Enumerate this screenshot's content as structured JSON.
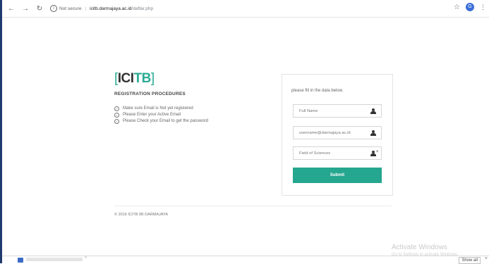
{
  "browser": {
    "security_label": "Not secure",
    "domain": "icitb.darmajaya.ac.id",
    "path": "/daftar.php",
    "profile_initial": "G"
  },
  "logo": {
    "ici": "ICI",
    "tb": "TB",
    "open_bracket": "[",
    "close_bracket": "]"
  },
  "procedures": {
    "title": "REGISTRATION PROCEDURES",
    "steps": [
      "Make sure Email is Not yet registered",
      "Please Enter your Active Email",
      "Please Check your Email to get the password"
    ]
  },
  "form": {
    "intro": "please fill in the data below.",
    "fields": [
      {
        "placeholder": "Full Name",
        "icon": "user-icon"
      },
      {
        "placeholder": "username@darmajaya.ac.id",
        "icon": "user-icon"
      },
      {
        "placeholder": "Field of Sciences",
        "icon": "user-add-icon"
      }
    ],
    "submit_label": "Submit"
  },
  "footer": {
    "copyright": "© 2016 ICITB IBI DARMAJAYA"
  },
  "os_watermark": {
    "line1": "Activate Windows",
    "line2": "Go to Settings to activate Windows."
  },
  "download_bar": {
    "show_all_label": "Show all",
    "close_glyph": "×"
  },
  "colors": {
    "accent": "#25a68f",
    "accent_text": "#2bab94"
  }
}
